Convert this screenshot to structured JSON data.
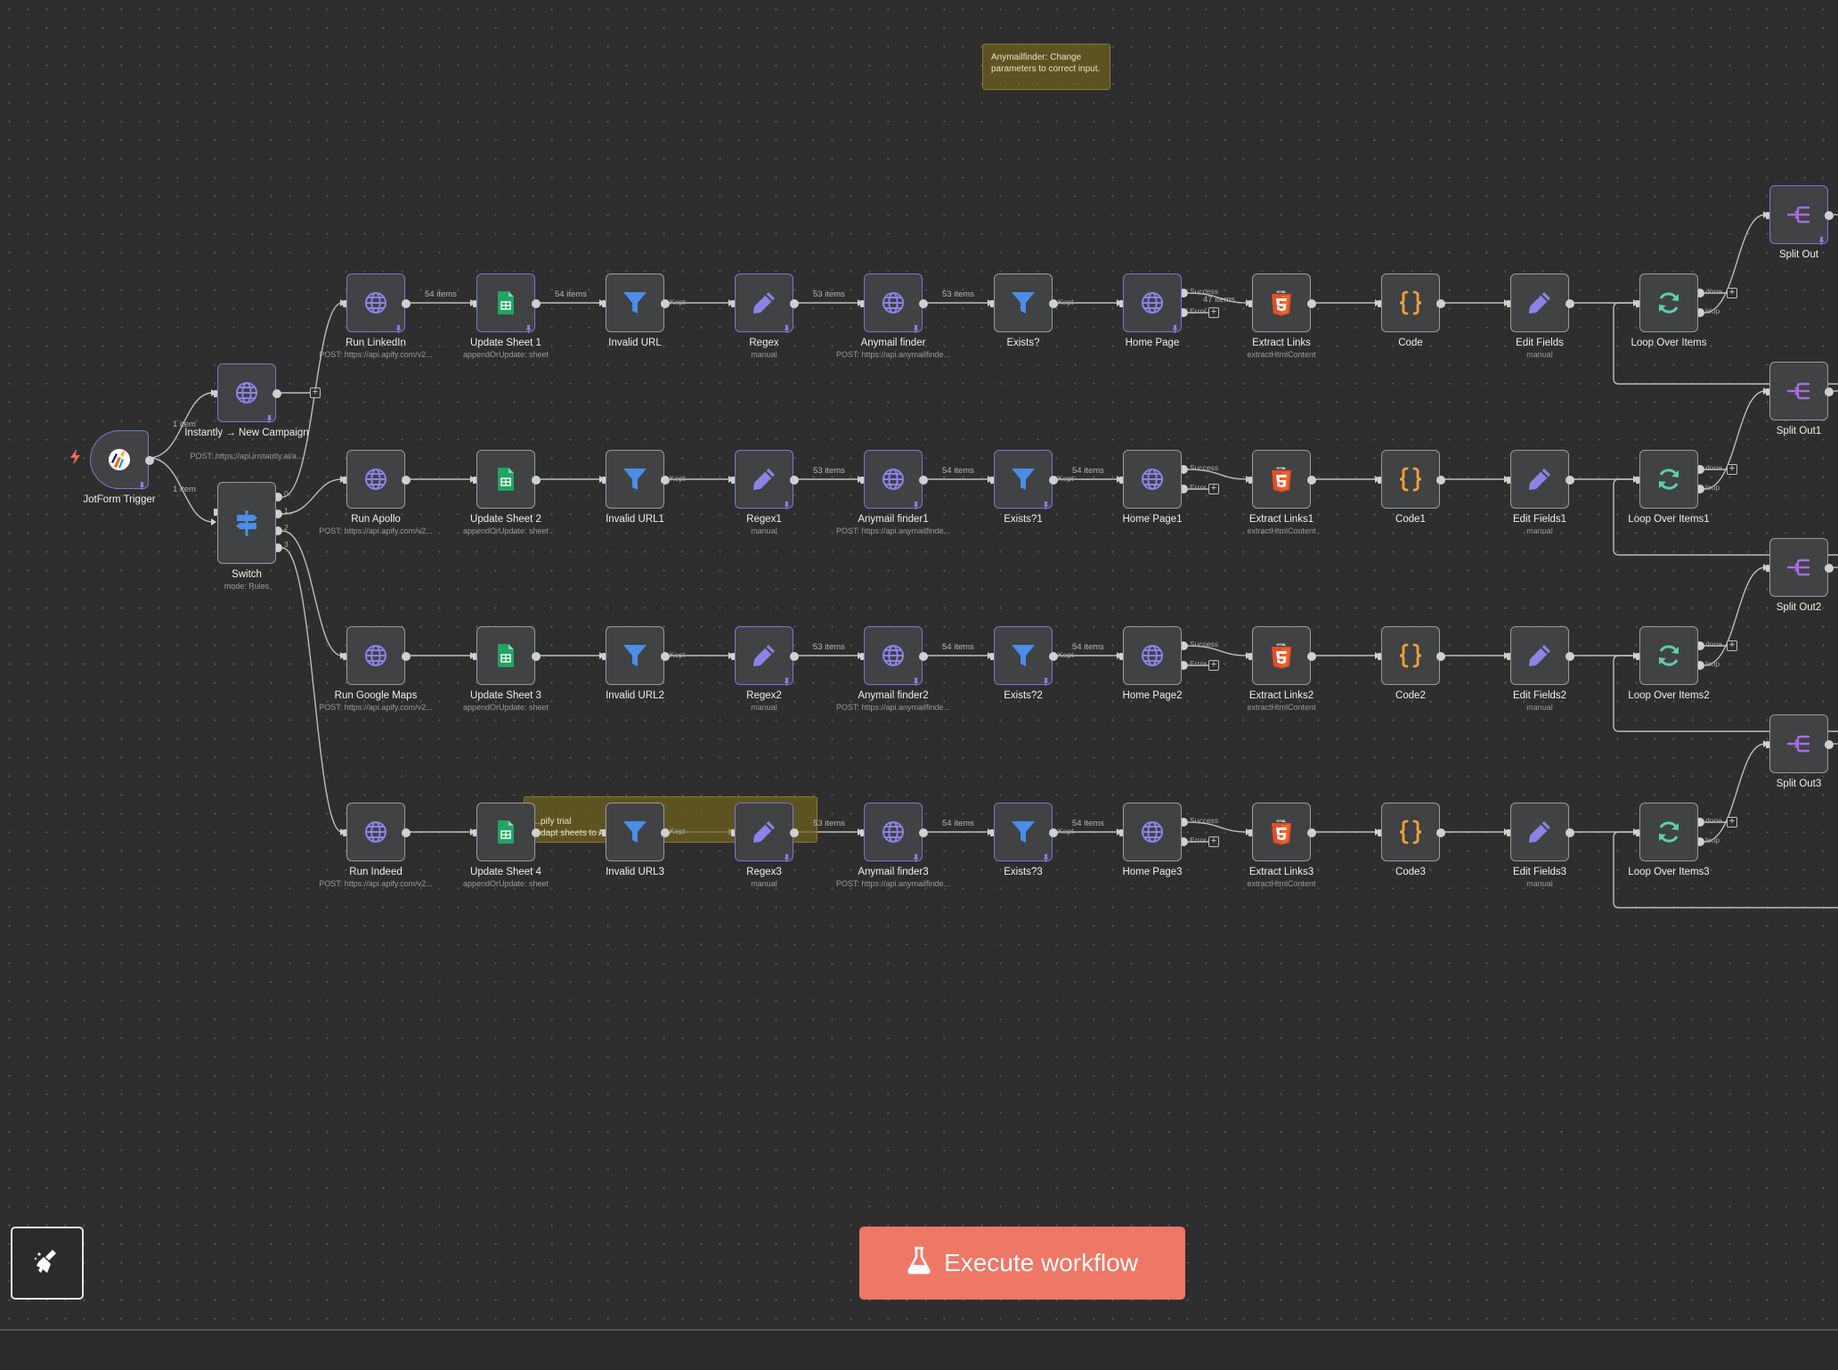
{
  "colors": {
    "canvas": "#2e2e2e",
    "accent_button": "#ee7766",
    "node_border_pinned": "#7c74d8",
    "sticky": "#70621e"
  },
  "sticky_notes": [
    {
      "id": "note-anymail",
      "text": "Anymailfinder: Change parameters to correct input."
    },
    {
      "id": "note-apify",
      "text": "…pify trial\n…dapt sheets to Ac…"
    }
  ],
  "nodes": {
    "trigger": {
      "label": "JotForm Trigger",
      "icon": "jotform-icon"
    },
    "instantly": {
      "label": "Instantly → New Campaign",
      "sub": "POST: https://api.instantly.ai/a...",
      "icon": "globe-icon"
    },
    "switch": {
      "label": "Switch",
      "sub": "mode: Rules",
      "icon": "switch-signpost-icon",
      "outputs": [
        "0",
        "1",
        "2",
        "3"
      ]
    },
    "row0": [
      {
        "label": "Run LinkedIn",
        "sub": "POST: https://api.apify.com/v2...",
        "icon": "globe-icon"
      },
      {
        "label": "Update Sheet 1",
        "sub": "appendOrUpdate: sheet",
        "icon": "google-sheets-icon"
      },
      {
        "label": "Invalid URL",
        "sub": "",
        "icon": "filter-icon"
      },
      {
        "label": "Regex",
        "sub": "manual",
        "icon": "pencil-icon"
      },
      {
        "label": "Anymail finder",
        "sub": "POST: https://api.anymailfinde...",
        "icon": "globe-icon"
      },
      {
        "label": "Exists?",
        "sub": "",
        "icon": "filter-icon"
      },
      {
        "label": "Home Page",
        "sub": "",
        "icon": "globe-icon"
      },
      {
        "label": "Extract Links",
        "sub": "extractHtmlContent",
        "icon": "html5-icon"
      },
      {
        "label": "Code",
        "sub": "",
        "icon": "code-braces-icon"
      },
      {
        "label": "Edit Fields",
        "sub": "manual",
        "icon": "pencil-icon"
      },
      {
        "label": "Loop Over Items",
        "sub": "",
        "icon": "loop-icon"
      }
    ],
    "row1": [
      {
        "label": "Run Apollo",
        "sub": "POST: https://api.apify.com/v2...",
        "icon": "globe-icon"
      },
      {
        "label": "Update Sheet 2",
        "sub": "appendOrUpdate: sheet",
        "icon": "google-sheets-icon"
      },
      {
        "label": "Invalid URL1",
        "sub": "",
        "icon": "filter-icon"
      },
      {
        "label": "Regex1",
        "sub": "manual",
        "icon": "pencil-icon"
      },
      {
        "label": "Anymail finder1",
        "sub": "POST: https://api.anymailfinde...",
        "icon": "globe-icon"
      },
      {
        "label": "Exists?1",
        "sub": "",
        "icon": "filter-icon"
      },
      {
        "label": "Home Page1",
        "sub": "",
        "icon": "globe-icon"
      },
      {
        "label": "Extract Links1",
        "sub": "extractHtmlContent",
        "icon": "html5-icon"
      },
      {
        "label": "Code1",
        "sub": "",
        "icon": "code-braces-icon"
      },
      {
        "label": "Edit Fields1",
        "sub": "manual",
        "icon": "pencil-icon"
      },
      {
        "label": "Loop Over Items1",
        "sub": "",
        "icon": "loop-icon"
      }
    ],
    "row2": [
      {
        "label": "Run Google Maps",
        "sub": "POST: https://api.apify.com/v2...",
        "icon": "globe-icon"
      },
      {
        "label": "Update Sheet 3",
        "sub": "appendOrUpdate: sheet",
        "icon": "google-sheets-icon"
      },
      {
        "label": "Invalid URL2",
        "sub": "",
        "icon": "filter-icon"
      },
      {
        "label": "Regex2",
        "sub": "manual",
        "icon": "pencil-icon"
      },
      {
        "label": "Anymail finder2",
        "sub": "POST: https://api.anymailfinde...",
        "icon": "globe-icon"
      },
      {
        "label": "Exists?2",
        "sub": "",
        "icon": "filter-icon"
      },
      {
        "label": "Home Page2",
        "sub": "",
        "icon": "globe-icon"
      },
      {
        "label": "Extract Links2",
        "sub": "extractHtmlContent",
        "icon": "html5-icon"
      },
      {
        "label": "Code2",
        "sub": "",
        "icon": "code-braces-icon"
      },
      {
        "label": "Edit Fields2",
        "sub": "manual",
        "icon": "pencil-icon"
      },
      {
        "label": "Loop Over Items2",
        "sub": "",
        "icon": "loop-icon"
      }
    ],
    "row3": [
      {
        "label": "Run Indeed",
        "sub": "POST: https://api.apify.com/v2...",
        "icon": "globe-icon"
      },
      {
        "label": "Update Sheet 4",
        "sub": "appendOrUpdate: sheet",
        "icon": "google-sheets-icon"
      },
      {
        "label": "Invalid URL3",
        "sub": "",
        "icon": "filter-icon"
      },
      {
        "label": "Regex3",
        "sub": "manual",
        "icon": "pencil-icon"
      },
      {
        "label": "Anymail finder3",
        "sub": "POST: https://api.anymailfinde...",
        "icon": "globe-icon"
      },
      {
        "label": "Exists?3",
        "sub": "",
        "icon": "filter-icon"
      },
      {
        "label": "Home Page3",
        "sub": "",
        "icon": "globe-icon"
      },
      {
        "label": "Extract Links3",
        "sub": "extractHtmlContent",
        "icon": "html5-icon"
      },
      {
        "label": "Code3",
        "sub": "",
        "icon": "code-braces-icon"
      },
      {
        "label": "Edit Fields3",
        "sub": "manual",
        "icon": "pencil-icon"
      },
      {
        "label": "Loop Over Items3",
        "sub": "",
        "icon": "loop-icon"
      }
    ],
    "split_outs": [
      {
        "label": "Split Out",
        "icon": "split-out-icon"
      },
      {
        "label": "Split Out1",
        "icon": "split-out-icon"
      },
      {
        "label": "Split Out2",
        "icon": "split-out-icon"
      },
      {
        "label": "Split Out3",
        "icon": "split-out-icon"
      }
    ]
  },
  "edge_labels": {
    "one_item": "1 item",
    "row0": [
      "54 items",
      "54 items",
      "53 items",
      "53 items",
      "47 items"
    ],
    "row1": [
      "53 items",
      "54 items",
      "54 items"
    ],
    "row2": [
      "53 items",
      "54 items",
      "54 items"
    ],
    "row3": [
      "53 items",
      "54 items",
      "54 items"
    ]
  },
  "port_labels": {
    "kept": "Kept",
    "success": "Success",
    "error": "Error",
    "done": "done",
    "loop": "loop"
  },
  "toolbar": {
    "execute_label": "Execute workflow",
    "execute_icon": "flask-icon",
    "clean_icon": "broom-icon"
  }
}
